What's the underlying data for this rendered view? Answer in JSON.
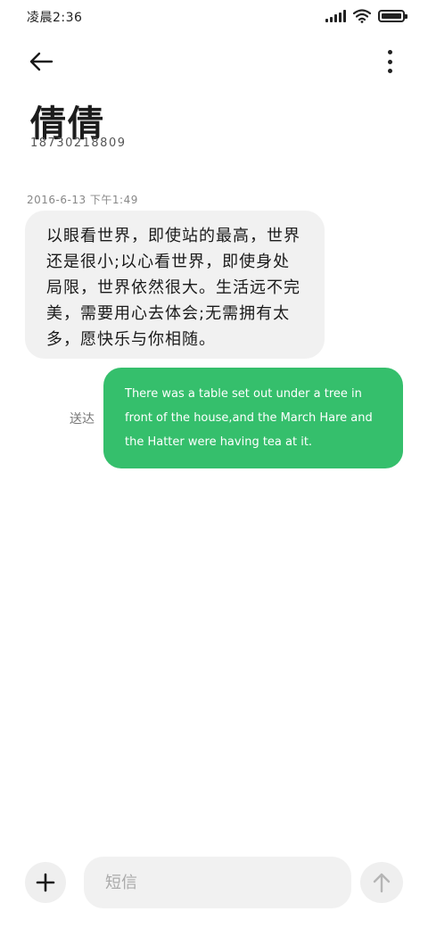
{
  "status_bar": {
    "time": "凌晨2:36",
    "icons": [
      "signal-icon",
      "wifi-icon",
      "battery-icon"
    ]
  },
  "header": {
    "back_icon": "arrow-left-icon",
    "more_icon": "more-vertical-icon"
  },
  "contact": {
    "name": "倩倩",
    "number": "18730218809"
  },
  "conversation": {
    "timestamp": "2016-6-13 下午1:49",
    "incoming_message": "以眼看世界，即使站的最高，世界还是很小;以心看世界，即使身处局限，世界依然很大。生活远不完美，需要用心去体会;无需拥有太多，愿快乐与你相随。",
    "outgoing_message": "There was a table set out under a tree in front of the house,and the March Hare and the Hatter were having tea at it.",
    "outgoing_status": "送达"
  },
  "composer": {
    "placeholder": "短信",
    "add_icon": "plus-icon",
    "send_icon": "arrow-up-icon"
  },
  "colors": {
    "outgoing_bubble": "#35bf6c",
    "incoming_bubble": "#f1f1f1"
  }
}
